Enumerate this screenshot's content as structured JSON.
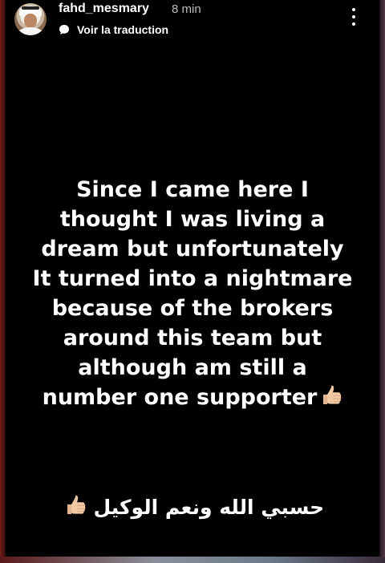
{
  "header": {
    "username": "fahd_mesmary",
    "time": "8 min",
    "translate_label": "Voir la traduction",
    "menu_icon": "more-vertical-icon",
    "translate_icon": "translate-bubble-icon"
  },
  "story": {
    "caption_lines": [
      "Since I came here I",
      "thought I was living a",
      "dream but unfortunately",
      "It turned into a nightmare",
      "because of the brokers",
      "around this team but",
      "although am still a",
      "number one supporter"
    ],
    "caption_emoji_icon": "thumbs-up-icon",
    "arabic_text": "حسبي الله ونعم الوكيل",
    "arabic_emoji_icon": "thumbs-up-icon"
  },
  "colors": {
    "background": "#000000",
    "text": "#ffffff",
    "muted": "#bdbdbd",
    "thumb": "#f1c9a5"
  }
}
